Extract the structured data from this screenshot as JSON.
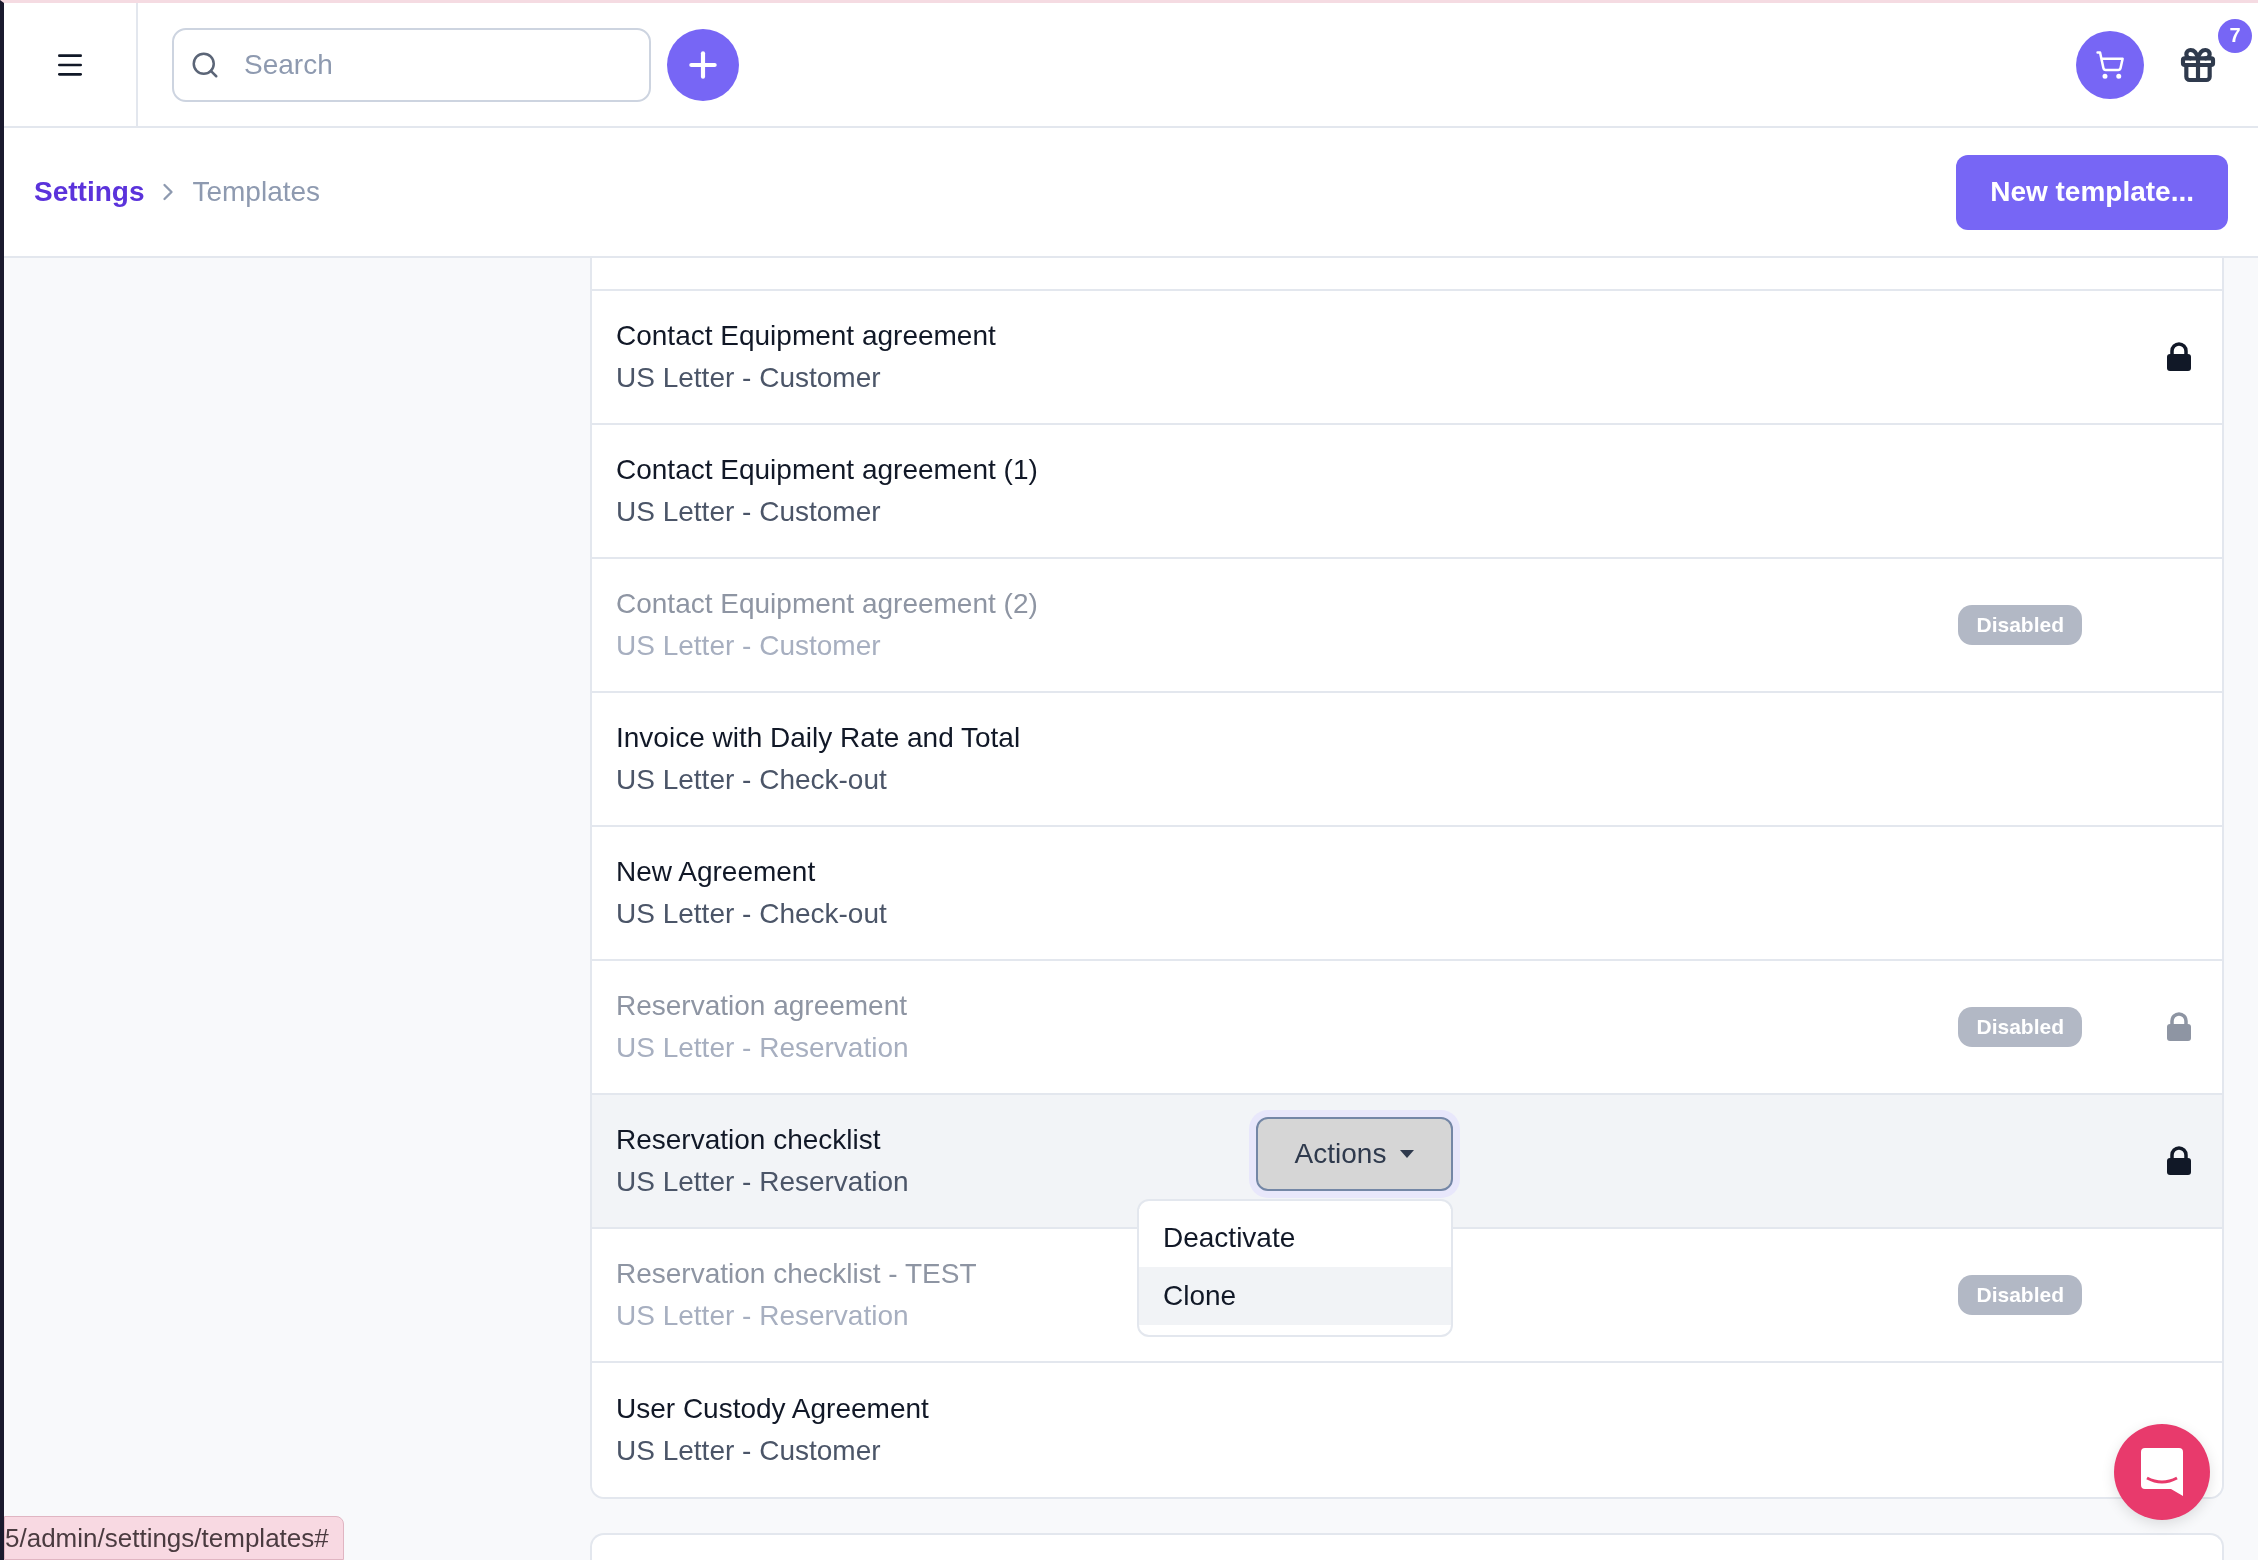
{
  "topbar": {
    "search": {
      "placeholder": "Search"
    },
    "gift_count": "7"
  },
  "breadcrumb": {
    "items": [
      {
        "label": "Settings",
        "current": false
      },
      {
        "label": "Templates",
        "current": true
      }
    ],
    "action": "New template..."
  },
  "templates": [
    {
      "title": "Contact Equipment agreement",
      "subtitle": "US Letter - Customer",
      "disabled": false,
      "locked": true,
      "hovered": false
    },
    {
      "title": "Contact Equipment agreement (1)",
      "subtitle": "US Letter - Customer",
      "disabled": false,
      "locked": false,
      "hovered": false
    },
    {
      "title": "Contact Equipment agreement (2)",
      "subtitle": "US Letter - Customer",
      "disabled": true,
      "badge": "Disabled",
      "locked": false,
      "hovered": false
    },
    {
      "title": "Invoice with Daily Rate and Total",
      "subtitle": "US Letter - Check-out",
      "disabled": false,
      "locked": false,
      "hovered": false
    },
    {
      "title": "New Agreement",
      "subtitle": "US Letter - Check-out",
      "disabled": false,
      "locked": false,
      "hovered": false
    },
    {
      "title": "Reservation agreement",
      "subtitle": "US Letter - Reservation",
      "disabled": true,
      "badge": "Disabled",
      "locked": true,
      "hovered": false
    },
    {
      "title": "Reservation checklist",
      "subtitle": "US Letter - Reservation",
      "disabled": false,
      "locked": true,
      "hovered": true,
      "actions": {
        "button": "Actions",
        "items": [
          {
            "label": "Deactivate",
            "highlighted": false
          },
          {
            "label": "Clone",
            "highlighted": true
          }
        ]
      }
    },
    {
      "title": "Reservation checklist - TEST",
      "subtitle": "US Letter - Reservation",
      "disabled": true,
      "badge": "Disabled",
      "locked": false,
      "hovered": false
    },
    {
      "title": "User Custody Agreement",
      "subtitle": "US Letter - Customer",
      "disabled": false,
      "locked": false,
      "hovered": false
    }
  ],
  "status_url": "5/admin/settings/templates#"
}
